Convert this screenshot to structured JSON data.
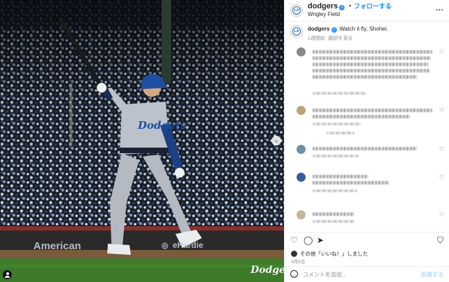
{
  "post": {
    "username": "dodgers",
    "follow_label": "フォローする",
    "location": "Wrigley Field",
    "more_icon": "more-horizontal-icon"
  },
  "caption": {
    "username": "dodgers",
    "text": "Watch it fly, Shohei.",
    "time": "1週間前",
    "translate": "翻訳を見る"
  },
  "photo": {
    "jersey_text": "Dodgers",
    "banner_left": "American",
    "banner_right": "eHardie",
    "watermark": "Dodgers"
  },
  "comments": [
    {
      "avatar_color": "#8a8a8a"
    },
    {
      "avatar_color": "#b9a47a"
    },
    {
      "avatar_color": "#6f8fa8"
    },
    {
      "avatar_color": "#3a5aa0"
    },
    {
      "avatar_color": "#c0b79a"
    }
  ],
  "footer": {
    "likes_text": "その他「いいね！」しました",
    "date": "4月6日",
    "comment_placeholder": "コメントを追加...",
    "post_label": "投稿する"
  },
  "colors": {
    "accent": "#0095f6",
    "verified": "#3897f0",
    "dodger_blue": "#1e5aa8"
  }
}
